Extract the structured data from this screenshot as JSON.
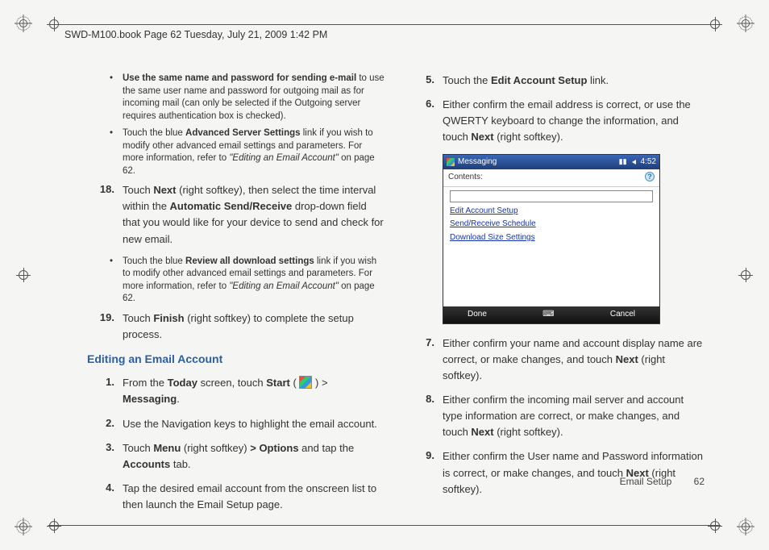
{
  "header_run": "SWD-M100.book  Page 62  Tuesday, July 21, 2009  1:42 PM",
  "col1": {
    "bul1_lead": "Use the same name and password for sending e-mail",
    "bul1_rest": " to use the same user name and password for outgoing mail as for incoming mail (can only be selected if the Outgoing server requires authentication box is checked).",
    "bul2_a": "Touch the blue ",
    "bul2_b": "Advanced Server Settings",
    "bul2_c": " link if you wish to modify other advanced email settings and parameters. For more information, refer to ",
    "bul2_d": "\"Editing an Email Account\"",
    "bul2_e": "  on page 62.",
    "n18_num": "18.",
    "n18_a": "Touch ",
    "n18_b": "Next",
    "n18_c": " (right softkey), then select the time interval within the ",
    "n18_d": "Automatic Send/Receive",
    "n18_e": " drop-down field that you would like for your device to send and check for new email.",
    "bul3_a": "Touch the blue ",
    "bul3_b": "Review all download settings",
    "bul3_c": " link if you wish to modify other advanced email settings and parameters. For more information, refer to ",
    "bul3_d": "\"Editing an Email Account\"",
    "bul3_e": "  on page 62.",
    "n19_num": "19.",
    "n19_a": "Touch ",
    "n19_b": "Finish",
    "n19_c": " (right softkey) to complete the setup process.",
    "section_title": "Editing an Email Account",
    "s1_num": "1.",
    "s1_a": "From the ",
    "s1_b": "Today",
    "s1_c": " screen, touch ",
    "s1_d": "Start",
    "s1_e": " ( ",
    "s1_f": " ) > ",
    "s1_g": "Messaging",
    "s1_h": ".",
    "s2_num": "2.",
    "s2": "Use the Navigation keys to highlight the email account.",
    "s3_num": "3.",
    "s3_a": "Touch ",
    "s3_b": "Menu",
    "s3_c": " (right softkey) ",
    "s3_d": "> Options",
    "s3_e": " and tap the ",
    "s3_f": "Accounts",
    "s3_g": " tab.",
    "s4_num": "4.",
    "s4": "Tap the desired email account from the onscreen list to then launch the Email Setup page."
  },
  "col2": {
    "n5_num": "5.",
    "n5_a": "Touch the ",
    "n5_b": "Edit Account Setup",
    "n5_c": " link.",
    "n6_num": "6.",
    "n6_a": "Either confirm the email address is correct, or use the QWERTY keyboard to change the information, and touch ",
    "n6_b": "Next",
    "n6_c": " (right softkey).",
    "ss": {
      "title": "Messaging",
      "time": "4:52",
      "contents": "Contents:",
      "link1": "Edit Account Setup",
      "link2": "Send/Receive Schedule",
      "link3": "Download Size Settings",
      "done": "Done",
      "cancel": "Cancel"
    },
    "n7_num": "7.",
    "n7_a": "Either confirm your name and account display name are correct, or make changes, and touch ",
    "n7_b": "Next",
    "n7_c": " (right softkey).",
    "n8_num": "8.",
    "n8_a": "Either confirm the incoming mail server and account type information are correct, or make changes, and touch ",
    "n8_b": "Next",
    "n8_c": " (right softkey).",
    "n9_num": "9.",
    "n9_a": "Either confirm the User name and Password information is correct, or make changes, and touch ",
    "n9_b": "Next",
    "n9_c": " (right softkey)."
  },
  "footer": {
    "section": "Email Setup",
    "page": "62"
  }
}
